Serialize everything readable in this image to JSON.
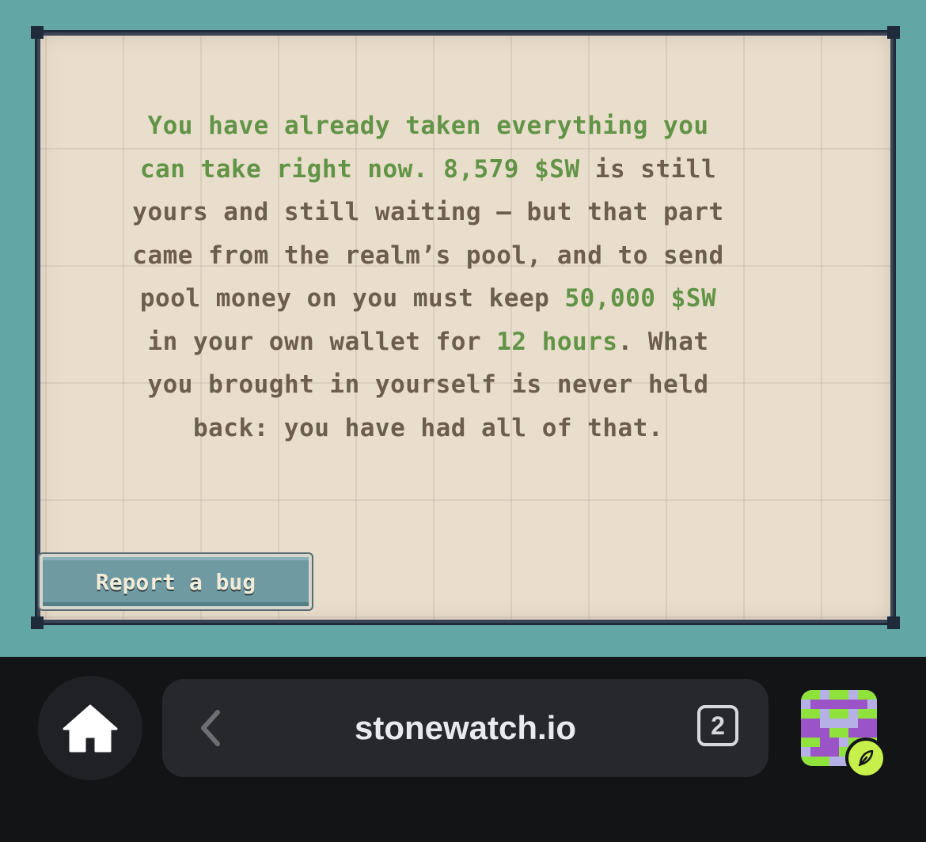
{
  "message": {
    "segments": [
      {
        "text": "You have already taken everything you can take right now. ",
        "highlight": true
      },
      {
        "text": "8,579 $SW",
        "highlight": true
      },
      {
        "text": " is still yours and still waiting – but that part came from the realm’s pool, and to send pool money on you must keep ",
        "highlight": false
      },
      {
        "text": "50,000 $SW",
        "highlight": true
      },
      {
        "text": " in your own wallet for ",
        "highlight": false
      },
      {
        "text": "12 hours",
        "highlight": true
      },
      {
        "text": ". What you brought in yourself is never held back: you have had all of that.",
        "highlight": false
      }
    ]
  },
  "report_bug_label": "Report a bug",
  "browser": {
    "url": "stonewatch.io",
    "tab_count": "2",
    "home_icon": "home-icon",
    "back_icon": "chevron-left-icon",
    "badge_icon": "feather-icon"
  },
  "colors": {
    "background": "#63a6a6",
    "panel": "#e9decb",
    "text": "#6b5e4c",
    "highlight": "#629447",
    "button": "#6f9aa2",
    "avatar_purple": "#9b54c8",
    "avatar_green": "#8fe13c",
    "avatar_lilac": "#b5b0e6"
  }
}
